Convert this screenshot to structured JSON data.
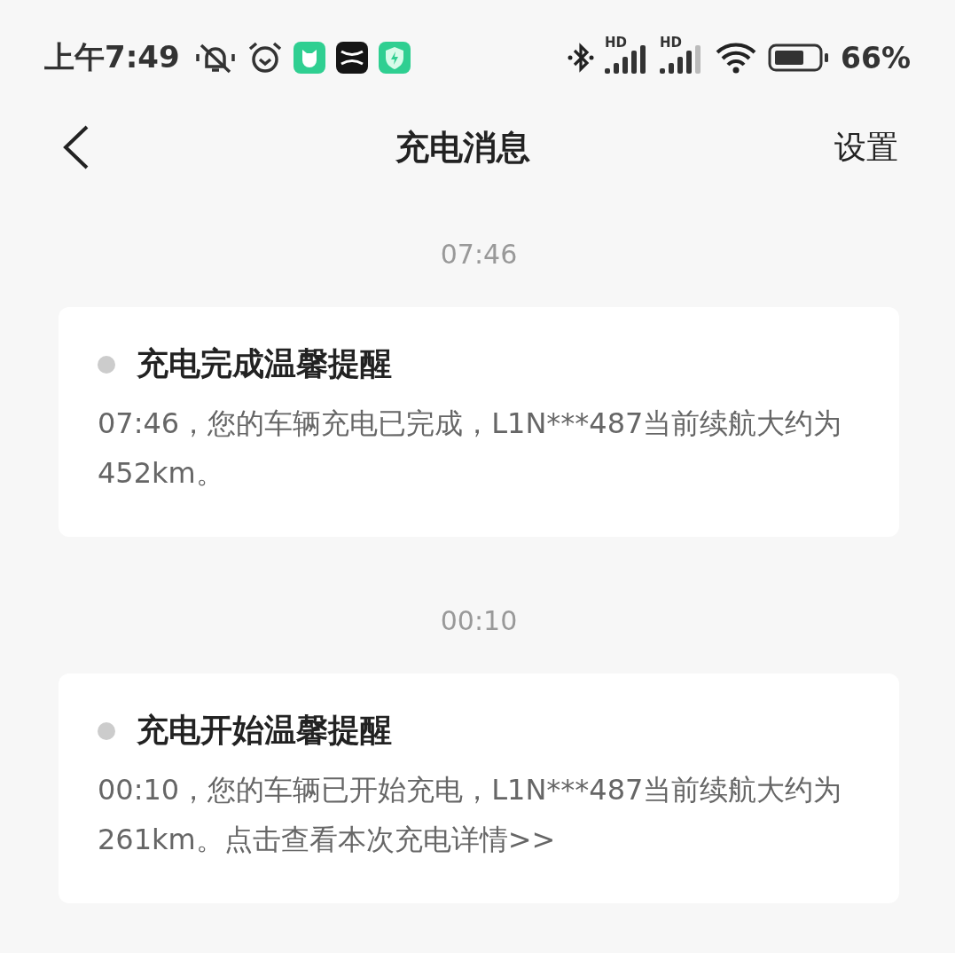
{
  "status_bar": {
    "time": "上午7:49",
    "signals": [
      {
        "label": "HD"
      },
      {
        "label": "HD"
      }
    ],
    "battery": "66%"
  },
  "header": {
    "title": "充电消息",
    "action": "设置"
  },
  "messages": [
    {
      "time": "07:46",
      "title": "充电完成温馨提醒",
      "body": "07:46，您的车辆充电已完成，L1N***487当前续航大约为452km。"
    },
    {
      "time": "00:10",
      "title": "充电开始温馨提醒",
      "body": "00:10，您的车辆已开始充电，L1N***487当前续航大约为261km。点击查看本次充电详情>>"
    }
  ]
}
